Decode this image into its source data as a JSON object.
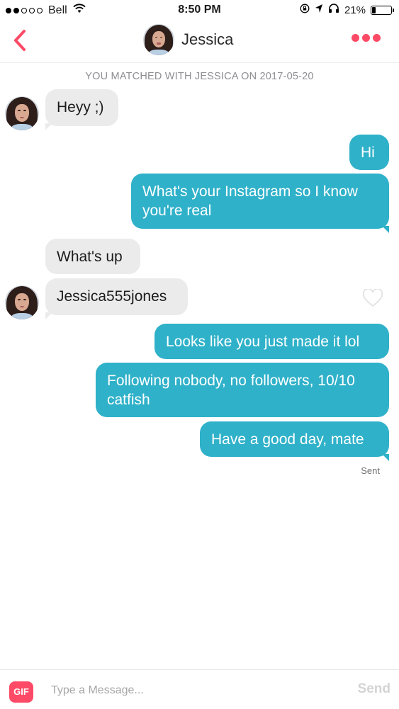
{
  "status_bar": {
    "carrier": "Bell",
    "signal_bars": 2,
    "time": "8:50 PM",
    "battery": "21%",
    "battery_level": 0.21,
    "icons": [
      "wifi-icon",
      "orientation-lock-icon",
      "location-arrow-icon",
      "headphones-icon",
      "battery-icon"
    ]
  },
  "header": {
    "name": "Jessica",
    "back_icon": "chevron-left-icon",
    "more_icon": "more-dots-icon",
    "accent_color": "#fd4a66"
  },
  "chat": {
    "match_label": "YOU MATCHED WITH JESSICA ON 2017-05-20",
    "messages": [
      {
        "from": "them",
        "text": "Heyy ;)"
      },
      {
        "from": "me",
        "text": "Hi"
      },
      {
        "from": "me",
        "text": "What's your Instagram so I know you're real"
      },
      {
        "from": "them",
        "text": "What's up"
      },
      {
        "from": "them",
        "text": "Jessica555jones"
      },
      {
        "from": "me",
        "text": "Looks like you just made it lol"
      },
      {
        "from": "me",
        "text": "Following nobody, no followers, 10/10 catfish"
      },
      {
        "from": "me",
        "text": "Have a good day, mate"
      }
    ],
    "sent_status": "Sent",
    "like_icon": "heart-outline-icon",
    "outgoing_color": "#2fb1c9",
    "incoming_color": "#ebebeb"
  },
  "composer": {
    "gif_label": "GIF",
    "placeholder": "Type a Message...",
    "value": "",
    "send_label": "Send"
  }
}
